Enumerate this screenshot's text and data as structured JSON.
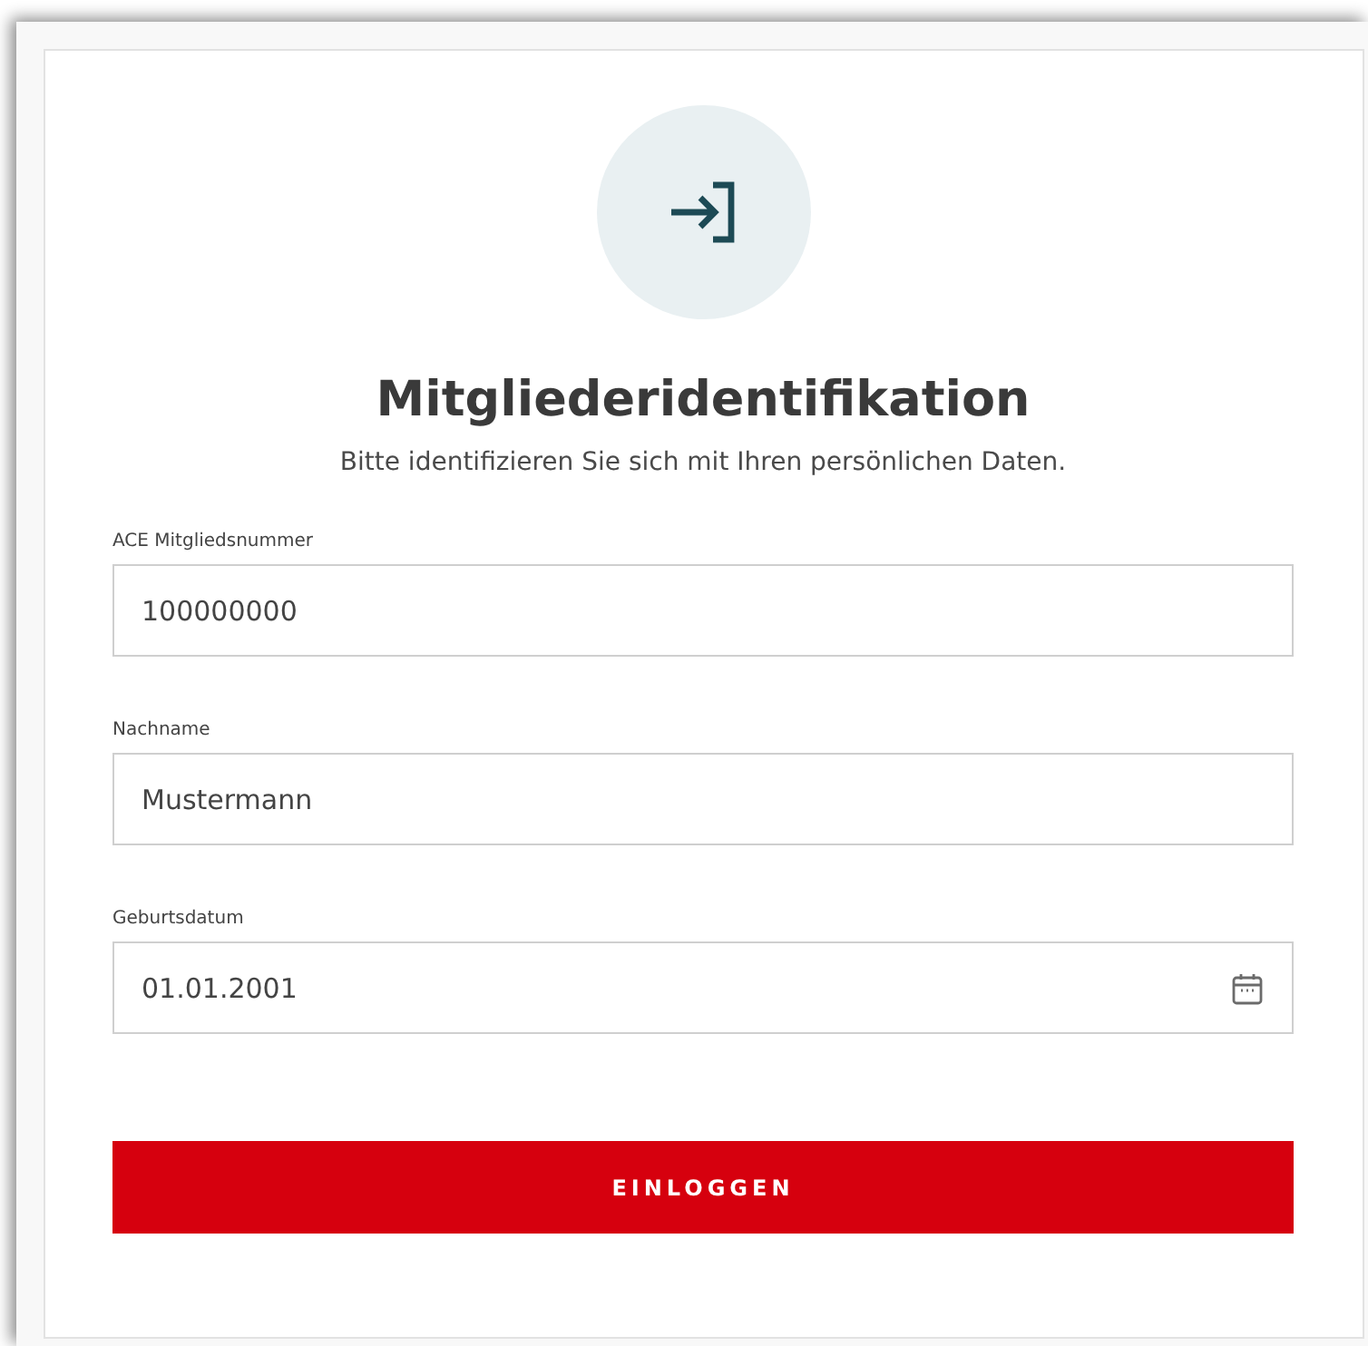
{
  "title": "Mitgliederidentifikation",
  "subtitle": "Bitte identifizieren Sie sich mit Ihren persönlichen Daten.",
  "fields": [
    {
      "label": "ACE Mitgliedsnummer",
      "value": "100000000",
      "kind": "text"
    },
    {
      "label": "Nachname",
      "value": "Mustermann",
      "kind": "text"
    },
    {
      "label": "Geburtsdatum",
      "value": "01.01.2001",
      "kind": "date"
    }
  ],
  "submit": "EINLOGGEN"
}
